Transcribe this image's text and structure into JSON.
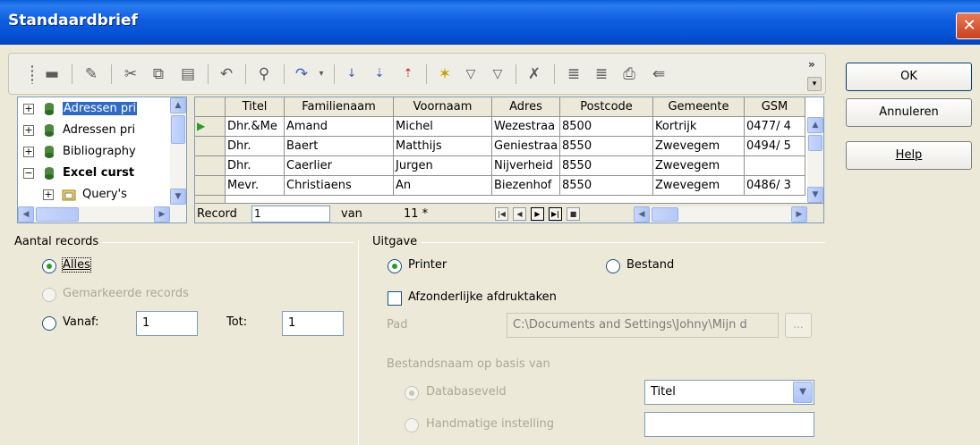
{
  "window": {
    "title": "Standaardbrief",
    "close_glyph": "✕"
  },
  "toolbar": {
    "icons": [
      "save-icon",
      "edit-icon",
      "cut-icon",
      "copy-icon",
      "paste-icon",
      "undo-icon",
      "find-icon",
      "redo-icon",
      "sort-ascending-icon",
      "sort-az-icon",
      "sort-za-icon",
      "autofilter-icon",
      "standard-filter-icon",
      "filter-icon",
      "remove-filter-icon",
      "data-to-text-icon",
      "data-to-fields-icon",
      "mail-merge-icon",
      "data-source-icon"
    ],
    "more": "»"
  },
  "buttons": {
    "ok": "OK",
    "cancel": "Annuleren",
    "help": "Help"
  },
  "tree": {
    "items": [
      {
        "label": "Adressen pri",
        "expander": "⊞",
        "selected": true,
        "bold": false
      },
      {
        "label": "Adressen pri",
        "expander": "⊞",
        "selected": false,
        "bold": false
      },
      {
        "label": "Bibliography",
        "expander": "⊞",
        "selected": false,
        "bold": false
      },
      {
        "label": "Excel curst",
        "expander": "⊟",
        "selected": false,
        "bold": true
      },
      {
        "label": "Query's",
        "expander": "⊞",
        "selected": false,
        "bold": false
      }
    ]
  },
  "grid": {
    "columns": [
      "Titel",
      "Familienaam",
      "Voornaam",
      "Adres",
      "Postcode",
      "Gemeente",
      "GSM"
    ],
    "rows": [
      [
        "Dhr.&Me",
        "Amand",
        "Michel",
        "Wezestraa",
        "8500",
        "Kortrijk",
        "0477/ 4"
      ],
      [
        "Dhr.",
        "Baert",
        "Matthijs",
        "Geniestraa",
        "8550",
        "Zwevegem",
        "0494/ 5"
      ],
      [
        "Dhr.",
        "Caerlier",
        "Jurgen",
        "Nijverheid",
        "8550",
        "Zwevegem",
        ""
      ],
      [
        "Mevr.",
        "Christiaens",
        "An",
        "Biezenhof",
        "8550",
        "Zwevegem",
        "0486/ 3"
      ]
    ],
    "current_row_marker": "▶",
    "nav": {
      "record_label": "Record",
      "record_value": "1",
      "of_label": "van",
      "count": "11 *"
    }
  },
  "aantal": {
    "group_title": "Aantal records",
    "all": "Alles",
    "marked": "Gemarkeerde records",
    "from": "Vanaf:",
    "from_value": "1",
    "to": "Tot:",
    "to_value": "1"
  },
  "uitgave": {
    "group_title": "Uitgave",
    "printer": "Printer",
    "file": "Bestand",
    "separate": "Afzonderlijke afdruktaken",
    "path_label": "Pad",
    "path_value": "C:\\Documents and Settings\\Johny\\Mijn d",
    "browse": "...",
    "filename_basis": "Bestandsnaam op basis van",
    "db_field": "Databaseveld",
    "db_field_value": "Titel",
    "manual": "Handmatige instelling",
    "manual_value": ""
  },
  "colors": {
    "title_bar": "#0551d4",
    "dialog_bg": "#ece9d8",
    "selection": "#316ac5",
    "radio_dot": "#21a121"
  }
}
